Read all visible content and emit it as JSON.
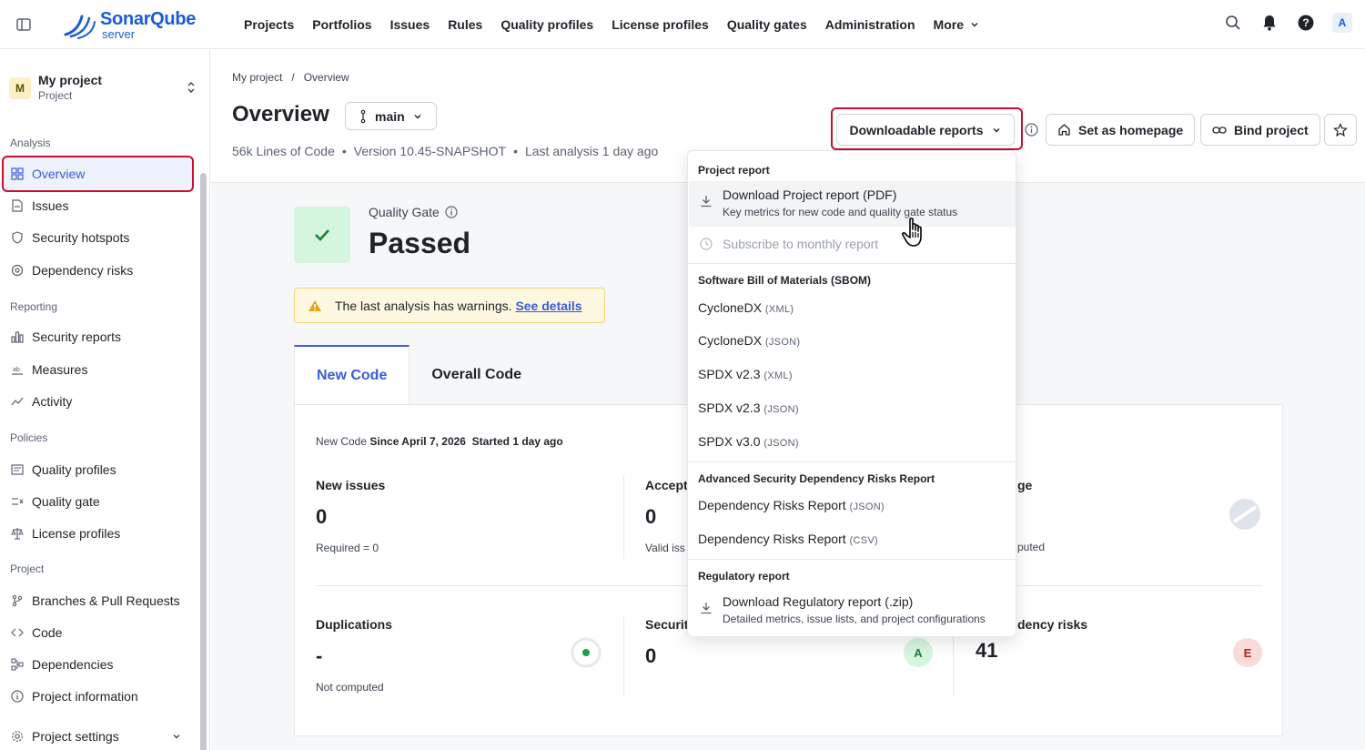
{
  "nav": {
    "logo_main": "SonarQube",
    "logo_sub": "server",
    "items": [
      "Projects",
      "Portfolios",
      "Issues",
      "Rules",
      "Quality profiles",
      "License profiles",
      "Quality gates",
      "Administration"
    ],
    "more": "More",
    "avatar": "A"
  },
  "sidebar": {
    "project_badge": "M",
    "project_name": "My project",
    "project_sub": "Project",
    "sections": {
      "analysis": "Analysis",
      "reporting": "Reporting",
      "policies": "Policies",
      "project": "Project"
    },
    "items": {
      "overview": "Overview",
      "issues": "Issues",
      "hotspots": "Security hotspots",
      "dep_risks": "Dependency risks",
      "security_reports": "Security reports",
      "measures": "Measures",
      "activity": "Activity",
      "quality_profiles": "Quality profiles",
      "quality_gate": "Quality gate",
      "license_profiles": "License profiles",
      "branches": "Branches & Pull Requests",
      "code": "Code",
      "dependencies": "Dependencies",
      "project_info": "Project information",
      "project_settings": "Project settings"
    }
  },
  "header": {
    "breadcrumb": [
      "My project",
      "/",
      "Overview"
    ],
    "title": "Overview",
    "branch": "main",
    "meta": [
      "56k Lines of Code",
      "•",
      "Version 10.45-SNAPSHOT",
      "•",
      "Last analysis 1 day ago"
    ],
    "downloadable_reports": "Downloadable reports",
    "set_homepage": "Set as homepage",
    "bind_project": "Bind project"
  },
  "quality_gate": {
    "label": "Quality Gate",
    "status": "Passed",
    "warning_text": "The last analysis has warnings.",
    "warning_link": "See details"
  },
  "tabs": [
    "New Code",
    "Overall Code"
  ],
  "panel": {
    "meta_prefix": "New Code",
    "meta_since": "Since April 7, 2026",
    "meta_started": "Started 1 day ago",
    "metrics": {
      "new_issues": {
        "title": "New issues",
        "value": "0",
        "sub": "Required = 0"
      },
      "accepted": {
        "title": "Accept",
        "value": "0",
        "sub": "Valid iss"
      },
      "coverage": {
        "title": "ge",
        "sub": "puted"
      },
      "duplications": {
        "title": "Duplications",
        "value": "-",
        "sub": "Not computed"
      },
      "security": {
        "title": "Securit",
        "value": "0",
        "grade": "A"
      },
      "dep_risks": {
        "title": "dency risks",
        "value": "41",
        "grade": "E"
      }
    }
  },
  "dropdown": {
    "sec_project": "Project report",
    "download_pdf": "Download Project report (PDF)",
    "download_pdf_sub": "Key metrics for new code and quality gate status",
    "subscribe": "Subscribe to monthly report",
    "sec_sbom": "Software Bill of Materials (SBOM)",
    "sbom": [
      {
        "name": "CycloneDX",
        "fmt": "(XML)"
      },
      {
        "name": "CycloneDX",
        "fmt": "(JSON)"
      },
      {
        "name": "SPDX v2.3",
        "fmt": "(XML)"
      },
      {
        "name": "SPDX v2.3",
        "fmt": "(JSON)"
      },
      {
        "name": "SPDX v3.0",
        "fmt": "(JSON)"
      }
    ],
    "sec_adv": "Advanced Security Dependency Risks Report",
    "adv": [
      {
        "name": "Dependency Risks Report",
        "fmt": "(JSON)"
      },
      {
        "name": "Dependency Risks Report",
        "fmt": "(CSV)"
      }
    ],
    "sec_reg": "Regulatory report",
    "download_reg": "Download Regulatory report (.zip)",
    "download_reg_sub": "Detailed metrics, issue lists, and project configurations"
  },
  "colors": {
    "accent": "#3b5bdb",
    "highlight_box": "#c8102e",
    "passed_bg": "#d6f5df",
    "passed_check": "#1a7f37"
  }
}
